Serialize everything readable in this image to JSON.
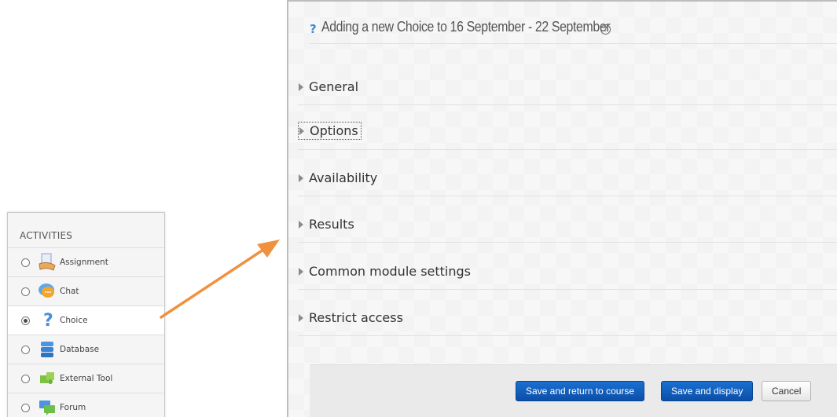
{
  "activities": {
    "title": "ACTIVITIES",
    "items": [
      {
        "label": "Assignment",
        "icon": "assignment-icon",
        "selected": false
      },
      {
        "label": "Chat",
        "icon": "chat-icon",
        "selected": false
      },
      {
        "label": "Choice",
        "icon": "question-icon",
        "selected": true
      },
      {
        "label": "Database",
        "icon": "database-icon",
        "selected": false
      },
      {
        "label": "External Tool",
        "icon": "puzzle-icon",
        "selected": false
      },
      {
        "label": "Forum",
        "icon": "forum-icon",
        "selected": false
      }
    ]
  },
  "form": {
    "title": "Adding a new Choice to 16 September - 22 September",
    "sections": [
      {
        "label": "General"
      },
      {
        "label": "Options",
        "focused": true
      },
      {
        "label": "Availability"
      },
      {
        "label": "Results"
      },
      {
        "label": "Common module settings"
      },
      {
        "label": "Restrict access"
      }
    ],
    "buttons": {
      "save_return": "Save and return to course",
      "save_display": "Save and display",
      "cancel": "Cancel"
    }
  },
  "colors": {
    "arrow": "#f0913f",
    "primary_button": "#0f5fbf",
    "question_icon": "#3f8bd8"
  }
}
